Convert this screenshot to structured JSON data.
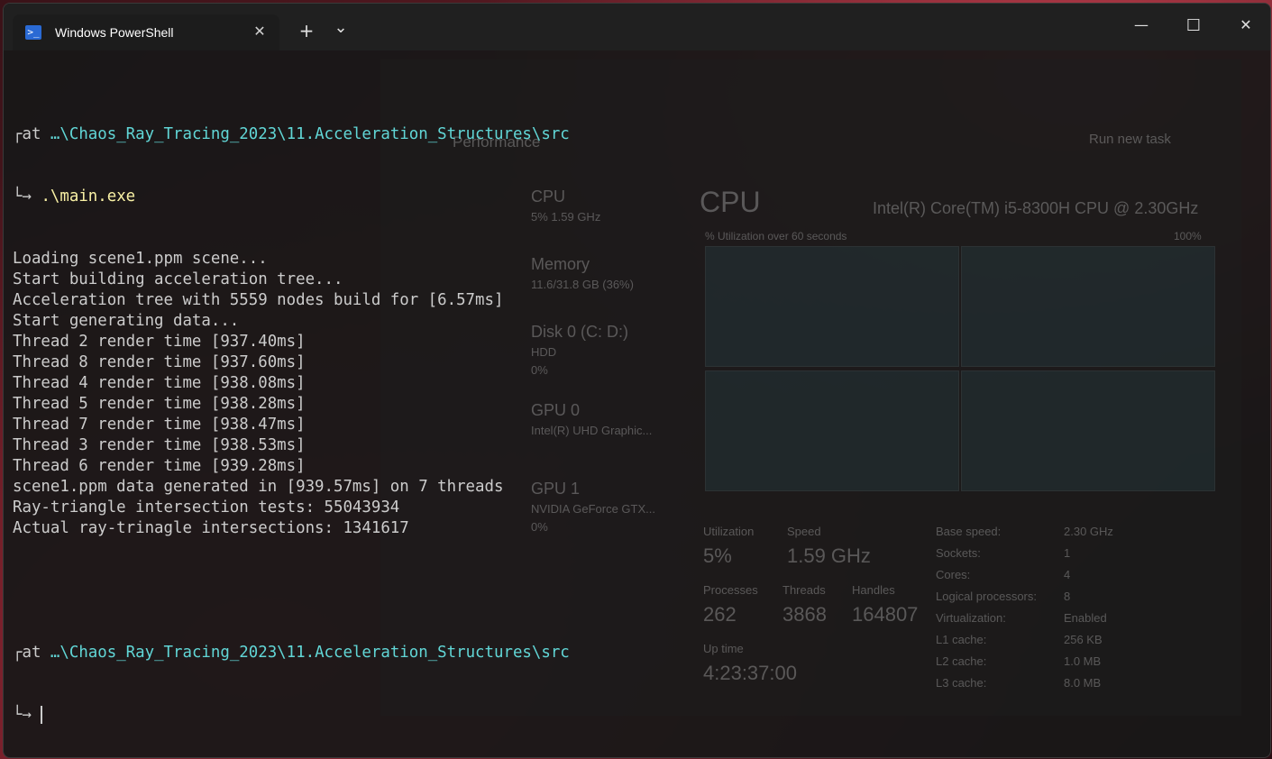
{
  "window": {
    "tab_title": "Windows PowerShell",
    "tab_icon": "powershell-icon",
    "new_tab": "+",
    "dropdown": "⌄",
    "minimize": "—",
    "maximize": "☐",
    "close": "✕"
  },
  "terminal": {
    "prompt1": {
      "prefix": "at ",
      "path": "…\\Chaos_Ray_Tracing_2023\\11.Acceleration_Structures\\src",
      "command": ".\\main.exe"
    },
    "output": [
      "Loading scene1.ppm scene...",
      "Start building acceleration tree...",
      "Acceleration tree with 5559 nodes build for [6.57ms]",
      "Start generating data...",
      "Thread 2 render time [937.40ms]",
      "Thread 8 render time [937.60ms]",
      "Thread 4 render time [938.08ms]",
      "Thread 5 render time [938.28ms]",
      "Thread 7 render time [938.47ms]",
      "Thread 3 render time [938.53ms]",
      "Thread 6 render time [939.28ms]",
      "scene1.ppm data generated in [939.57ms] on 7 threads",
      "Ray-triangle intersection tests: 55043934",
      "Actual ray-trinagle intersections: 1341617"
    ],
    "prompt2": {
      "prefix": "at ",
      "path": "…\\Chaos_Ray_Tracing_2023\\11.Acceleration_Structures\\src"
    },
    "arrow": "└→"
  },
  "taskmanager": {
    "title": "Performance",
    "run_task": "Run new task",
    "cpu_header": "CPU",
    "cpu_model": "Intel(R) Core(TM) i5-8300H CPU @ 2.30GHz",
    "util_caption": "% Utilization over 60 seconds",
    "util_max": "100%",
    "sidebar": [
      {
        "name": "CPU",
        "sub": "5% 1.59 GHz"
      },
      {
        "name": "Memory",
        "sub": "11.6/31.8 GB (36%)"
      },
      {
        "name": "Disk 0 (C: D:)",
        "sub": "HDD",
        "sub2": "0%"
      },
      {
        "name": "GPU 0",
        "sub": "Intel(R) UHD Graphic..."
      },
      {
        "name": "GPU 1",
        "sub": "NVIDIA GeForce GTX...",
        "sub2": "0%"
      }
    ],
    "stats": {
      "utilization_label": "Utilization",
      "utilization": "5%",
      "speed_label": "Speed",
      "speed": "1.59 GHz",
      "processes_label": "Processes",
      "processes": "262",
      "threads_label": "Threads",
      "threads": "3868",
      "handles_label": "Handles",
      "handles": "164807",
      "uptime_label": "Up time",
      "uptime": "4:23:37:00"
    },
    "specs": [
      {
        "k": "Base speed:",
        "v": "2.30 GHz"
      },
      {
        "k": "Sockets:",
        "v": "1"
      },
      {
        "k": "Cores:",
        "v": "4"
      },
      {
        "k": "Logical processors:",
        "v": "8"
      },
      {
        "k": "Virtualization:",
        "v": "Enabled"
      },
      {
        "k": "L1 cache:",
        "v": "256 KB"
      },
      {
        "k": "L2 cache:",
        "v": "1.0 MB"
      },
      {
        "k": "L3 cache:",
        "v": "8.0 MB"
      }
    ]
  }
}
